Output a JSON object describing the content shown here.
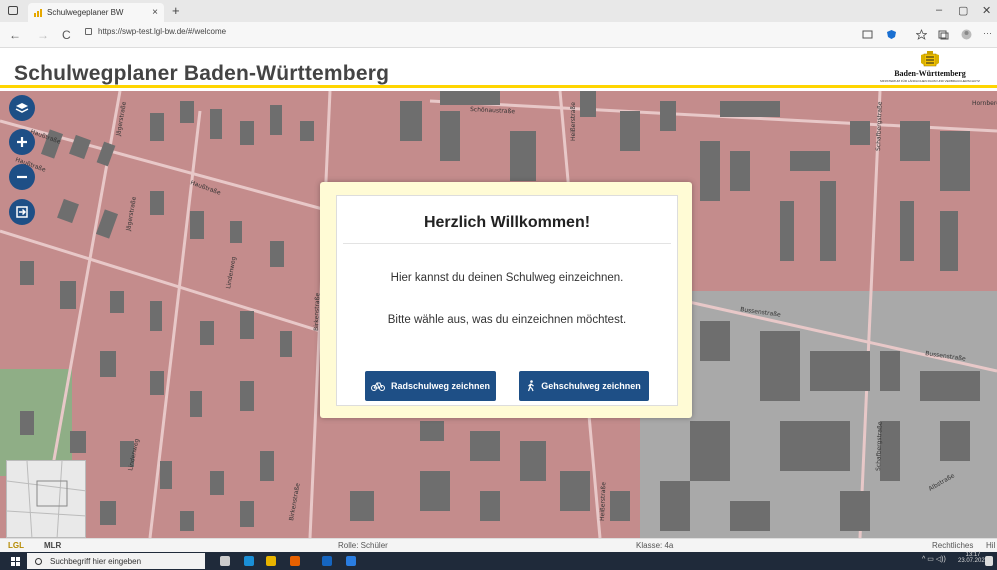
{
  "browser": {
    "tab_title": "Schulwegeplaner BW",
    "tab_close": "×",
    "new_tab": "+",
    "url": "https://swp-test.lgl-bw.de/#/welcome",
    "back": "←",
    "forward": "→",
    "reload": "C",
    "minimize": "–",
    "maximize": "▢",
    "close": "✕",
    "more": "···"
  },
  "header": {
    "title": "Schulwegplaner Baden-Württemberg",
    "logo_name": "Baden-Württemberg",
    "logo_sub": "MINISTERIUM FÜR LÄNDLICHEN RAUM UND VERBRAUCHERSCHUTZ"
  },
  "map": {
    "streets": [
      "Haußtraße",
      "Haußtraße",
      "Haußtraße",
      "Jägerstraße",
      "Jägerstraße",
      "Schönaustraße",
      "Heißerstraße",
      "Schafbergstraße",
      "Bussenstraße",
      "Bussenstraße",
      "Birkenstraße",
      "Birkenstraße",
      "Lindenweg",
      "Lindenweg",
      "Heißerstraße",
      "Schafbergstraße",
      "Albstraße",
      "Hornbergstraße"
    ]
  },
  "controls": {
    "layers": "layers-icon",
    "zoom_in": "plus-icon",
    "zoom_out": "minus-icon",
    "exit": "exit-icon"
  },
  "modal": {
    "title": "Herzlich Willkommen!",
    "line1": "Hier kannst du deinen Schulweg einzeichnen.",
    "line2": "Bitte wähle aus, was du einzeichnen möchtest.",
    "bike_button": "Radschulweg zeichnen",
    "walk_button": "Gehschulweg zeichnen"
  },
  "footer": {
    "lgl": "LGL",
    "mlr": "MLR",
    "role": "Rolle: Schüler",
    "class": "Klasse: 4a",
    "legal": "Rechtliches",
    "help": "Hil"
  },
  "taskbar": {
    "search_placeholder": "Suchbegriff hier eingeben",
    "time": "13:17",
    "date": "23.07.2021"
  },
  "colors": {
    "accent": "#1e4f86",
    "header_bar": "#ffd500",
    "map_base": "#c48c8c",
    "building": "#6e6e6e",
    "modal_frame": "#fffbd5"
  }
}
